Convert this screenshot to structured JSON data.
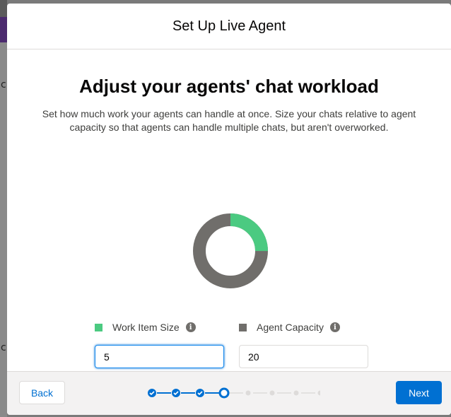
{
  "modal": {
    "title": "Set Up Live Agent",
    "heading": "Adjust your agents' chat workload",
    "description": "Set how much work your agents can handle at once. Size your chats relative to agent capacity so that agents can handle multiple chats, but aren't overworked."
  },
  "fields": {
    "work_item_size": {
      "label": "Work Item Size",
      "value": "5",
      "color": "#4bca81",
      "info_icon": "info-icon"
    },
    "agent_capacity": {
      "label": "Agent Capacity",
      "value": "20",
      "color": "#706e6b",
      "info_icon": "info-icon"
    }
  },
  "donut": {
    "filled": 5,
    "total": 20,
    "fill_color": "#4bca81",
    "rest_color": "#706e6b"
  },
  "footer": {
    "back_label": "Back",
    "next_label": "Next",
    "progress": {
      "total_steps": 8,
      "current_step": 4,
      "completed_steps": 3
    }
  },
  "colors": {
    "accent": "#0070d2",
    "success": "#4bca81",
    "neutral": "#706e6b"
  }
}
